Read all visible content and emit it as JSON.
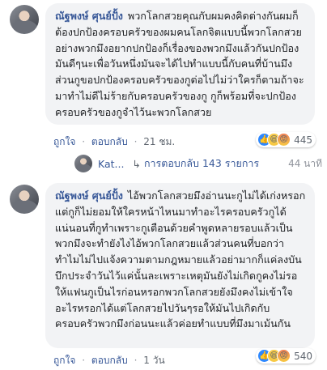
{
  "comments": [
    {
      "author": "ณัฐพงษ์ ศุนย์ปั้ง",
      "text": "พวกโลกสวยคุณกับผมคงคิดต่างกันผมก็ต้องปกป้องครอบครัวของผมคนโลกจิตแบบนี้พวกโลกสวยอย่างพวกมึงอยากปกป้องก็เรื่องของพวกมึงแล้วกันปกป้องมันดีๆนะเพื่อวันหนึ่งมันจะได้ไปทำแบบนี้กับคนที่บ้านมึงส่วนกูขอปกป้องครอบครัวของกูต่อไปไม่ว่าใครก็ตามถ้าจะมาทำไม่ดีไม่ร้ายกับครอบครัวของกู กูก็พร้อมที่จะปกป้องครอบครัวของกูจำไว้นะพวกโลกสวย",
      "like_label": "ถูกใจ",
      "reply_label": "ตอบกลับ",
      "time": "21 ชม.",
      "reaction_count": "445"
    },
    {
      "author": "ณัฐพงษ์ ศุนย์ปั้ง",
      "text": "ไอ้พวกโลกสวยมึงอ่านนะกูไม่ได้เก่งหรอกแต่กูก็ไม่ยอมให้ใครหน้าไหนมาทำอะไรครอบครัวกูได้แน่นอนที่กูทำเพราะกูเตือนด้วยคำพูดหลายรอบแล้วเป็นพวกมึงจะทำยังไงไอ้พวกโลกสวยแล้วส่วนคนที่บอกว่าทำไมไม่ไปแจ้งความตามกฎหมายแล้วอย่ามากก็แค่ลงบันบึกประจำวันไว้แค่นั้นละเพราะเหตุมันยังไม่เกิดกูคงไม่รอให้แฟนกูเป็นไรก่อนหรอกพวกโลกสวยยังมึงคงไม่เข้าใจอะไรหรอกได้แต่โลกสวยไปวันๆรอให้มันไปเกิดกับครอบครัวพวกมึงก่อนนะแล้วค่อยทำแบบที่มึงมาเม้นกัน",
      "like_label": "ถูกใจ",
      "reply_label": "ตอบกลับ",
      "time": "1 วัน",
      "reaction_count": "540"
    }
  ],
  "reply_summary": {
    "name": "Kat...",
    "arrow": "↳",
    "label": "การตอบกลับ 143 รายการ",
    "time": "44 นาที"
  },
  "separator": "·",
  "icons": {
    "like": "like-icon",
    "haha": "haha-icon",
    "angry": "angry-icon",
    "reply_arrow": "reply-arrow-icon"
  },
  "colors": {
    "link": "#385898",
    "bubble": "#f2f3f5",
    "meta": "#606770"
  }
}
